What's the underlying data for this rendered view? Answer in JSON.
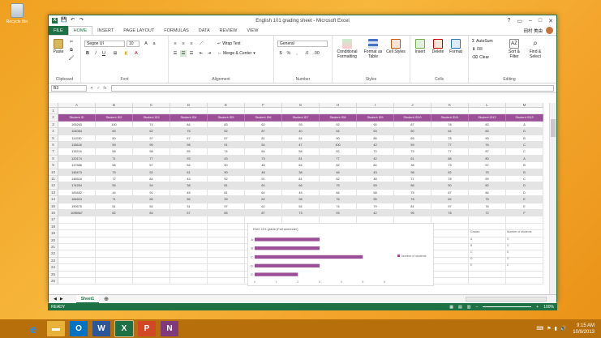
{
  "desktop": {
    "recycle_bin": "Recycle Bin"
  },
  "window": {
    "title": "English 101 grading sheet - Microsoft Excel",
    "controls": [
      "?",
      "▭",
      "–",
      "□",
      "✕"
    ]
  },
  "tabs": [
    "FILE",
    "HOME",
    "INSERT",
    "PAGE LAYOUT",
    "FORMULAS",
    "DATA",
    "REVIEW",
    "VIEW"
  ],
  "active_tab": "HOME",
  "user": {
    "name": "田村 美由"
  },
  "ribbon": {
    "clipboard": {
      "paste": "Paste",
      "label": "Clipboard"
    },
    "font": {
      "name": "Segoe UI",
      "size": "10",
      "label": "Font"
    },
    "alignment": {
      "wrap": "Wrap Text",
      "merge": "Merge & Center",
      "label": "Alignment"
    },
    "number": {
      "format": "General",
      "label": "Number"
    },
    "styles": {
      "cond": "Conditional Formatting",
      "table": "Format as Table",
      "cell": "Cell Styles",
      "label": "Styles"
    },
    "cells": {
      "insert": "Insert",
      "delete": "Delete",
      "format": "Format",
      "label": "Cells"
    },
    "editing": {
      "autosum": "AutoSum",
      "fill": "Fill",
      "clear": "Clear",
      "sort": "Sort & Filter",
      "find": "Find & Select",
      "label": "Editing"
    }
  },
  "formula_bar": {
    "name_box": "B3",
    "fx": "fx"
  },
  "columns": [
    "A",
    "B",
    "C",
    "D",
    "E",
    "F",
    "G",
    "H",
    "I",
    "J",
    "K",
    "L",
    "M"
  ],
  "rows": [
    "1",
    "2",
    "3",
    "4",
    "5",
    "6",
    "7",
    "8",
    "9",
    "10",
    "11",
    "12",
    "13",
    "14",
    "15",
    "16",
    "17",
    "18",
    "19",
    "20",
    "21",
    "22",
    "23",
    "24",
    "25",
    "26"
  ],
  "header_row": [
    "Student ID",
    "Student ID2",
    "Student ID3",
    "Student ID4",
    "Student ID5",
    "Student ID6",
    "Student ID7",
    "Student ID8",
    "Student ID9",
    "Student ID10",
    "Student ID11",
    "Student ID12",
    "Student ID13"
  ],
  "data_rows": [
    [
      "105263",
      "100",
      "74",
      "84",
      "83",
      "62",
      "93",
      "92",
      "90",
      "87",
      "78",
      "83",
      "A"
    ],
    [
      "104064",
      "69",
      "62",
      "75",
      "52",
      "87",
      "40",
      "54",
      "53",
      "50",
      "64",
      "83",
      "D"
    ],
    [
      "111030",
      "50",
      "97",
      "67",
      "57",
      "81",
      "64",
      "90",
      "86",
      "65",
      "78",
      "90",
      "B"
    ],
    [
      "115618",
      "59",
      "95",
      "98",
      "91",
      "54",
      "47",
      "100",
      "42",
      "59",
      "77",
      "76",
      "C"
    ],
    [
      "115216",
      "58",
      "98",
      "55",
      "74",
      "64",
      "58",
      "52",
      "70",
      "75",
      "77",
      "87",
      "C"
    ],
    [
      "120174",
      "71",
      "77",
      "93",
      "43",
      "73",
      "81",
      "77",
      "42",
      "61",
      "88",
      "80",
      "A"
    ],
    [
      "137586",
      "58",
      "57",
      "54",
      "50",
      "48",
      "64",
      "82",
      "84",
      "38",
      "73",
      "57",
      "B"
    ],
    [
      "145473",
      "79",
      "52",
      "51",
      "90",
      "48",
      "38",
      "46",
      "43",
      "98",
      "82",
      "75",
      "B"
    ],
    [
      "146518",
      "72",
      "84",
      "43",
      "92",
      "91",
      "81",
      "62",
      "48",
      "71",
      "78",
      "69",
      "C"
    ],
    [
      "174254",
      "55",
      "54",
      "38",
      "81",
      "60",
      "66",
      "75",
      "59",
      "86",
      "50",
      "82",
      "D"
    ],
    [
      "183482",
      "44",
      "91",
      "45",
      "81",
      "60",
      "45",
      "84",
      "58",
      "75",
      "87",
      "84",
      "D"
    ],
    [
      "184604",
      "71",
      "66",
      "56",
      "39",
      "62",
      "98",
      "76",
      "95",
      "78",
      "62",
      "75",
      "E"
    ],
    [
      "190575",
      "51",
      "54",
      "31",
      "97",
      "62",
      "54",
      "74",
      "79",
      "81",
      "97",
      "76",
      "E"
    ],
    [
      "1095567",
      "82",
      "84",
      "57",
      "65",
      "87",
      "73",
      "93",
      "42",
      "95",
      "78",
      "72",
      "F"
    ]
  ],
  "chart_data": {
    "type": "bar",
    "title": "ENG 101 grade (Fall semester)",
    "categories": [
      "A",
      "B",
      "C",
      "D",
      "E"
    ],
    "values": [
      3,
      3,
      5,
      3,
      2
    ],
    "legend": "Number of students",
    "xlim": [
      0,
      6
    ],
    "xticks": [
      "0",
      "1",
      "2",
      "3",
      "4",
      "5",
      "6"
    ],
    "color": "#9b4f96"
  },
  "side_labels": {
    "grades": "Grades",
    "count": "Number of students",
    "grade_list": [
      "A",
      "B",
      "C",
      "D",
      "E"
    ],
    "count_list": [
      "3",
      "3",
      "5",
      "3",
      "2"
    ]
  },
  "sheet_tab": "Sheet1",
  "status": {
    "ready": "READY",
    "zoom": "100%"
  },
  "taskbar": {
    "time": "9:15 AM",
    "date": "10/9/2013"
  }
}
